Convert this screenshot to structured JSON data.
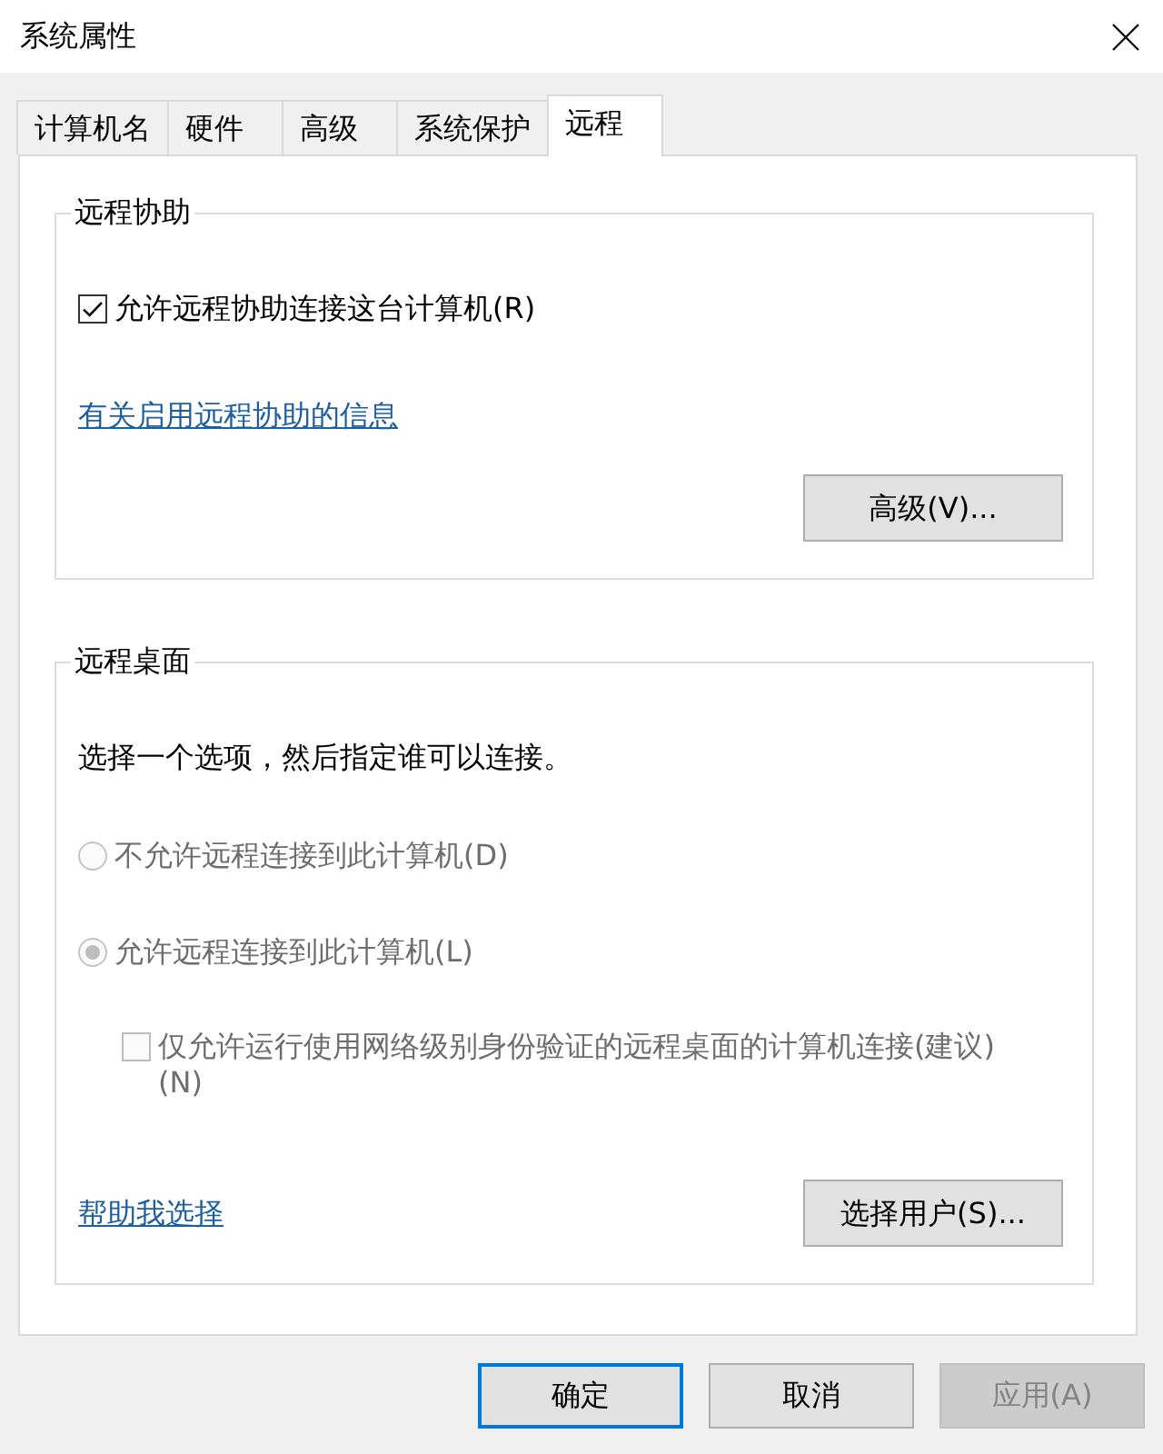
{
  "window": {
    "title": "系统属性"
  },
  "tabs": [
    {
      "label": "计算机名",
      "selected": false
    },
    {
      "label": "硬件",
      "selected": false
    },
    {
      "label": "高级",
      "selected": false
    },
    {
      "label": "系统保护",
      "selected": false
    },
    {
      "label": "远程",
      "selected": true
    }
  ],
  "remote_assistance": {
    "title": "远程协助",
    "allow": {
      "label": "允许远程协助连接这台计算机(R)",
      "checked": true
    },
    "info_link": "有关启用远程协助的信息",
    "advanced_button": "高级(V)..."
  },
  "remote_desktop": {
    "title": "远程桌面",
    "instruction": "选择一个选项，然后指定谁可以连接。",
    "options": [
      {
        "label": "不允许远程连接到此计算机(D)",
        "selected": false,
        "disabled": true
      },
      {
        "label": "允许远程连接到此计算机(L)",
        "selected": true,
        "disabled": true
      }
    ],
    "nla": {
      "label": "仅允许运行使用网络级别身份验证的远程桌面的计算机连接(建议)(N)",
      "checked": false,
      "disabled": true
    },
    "help_link": "帮助我选择",
    "select_users_button": "选择用户(S)..."
  },
  "buttons": [
    {
      "label": "确定",
      "default": true,
      "disabled": false
    },
    {
      "label": "取消",
      "default": false,
      "disabled": false
    },
    {
      "label": "应用(A)",
      "default": false,
      "disabled": true
    }
  ]
}
